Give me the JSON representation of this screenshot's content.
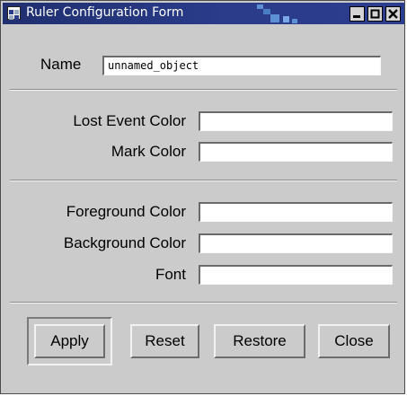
{
  "window": {
    "title": "Ruler Configuration Form",
    "icon": "app-icon",
    "controls": [
      "minimize-icon",
      "maximize-icon",
      "close-icon"
    ],
    "accent": "#2a3c8a"
  },
  "form": {
    "name_label": "Name",
    "name_value": "unnamed_object",
    "lost_event_color_label": "Lost Event Color",
    "lost_event_color_value": "",
    "mark_color_label": "Mark Color",
    "mark_color_value": "",
    "foreground_color_label": "Foreground Color",
    "foreground_color_value": "",
    "background_color_label": "Background Color",
    "background_color_value": "",
    "font_label": "Font",
    "font_value": ""
  },
  "buttons": {
    "apply": "Apply",
    "reset": "Reset",
    "restore": "Restore",
    "close": "Close"
  }
}
